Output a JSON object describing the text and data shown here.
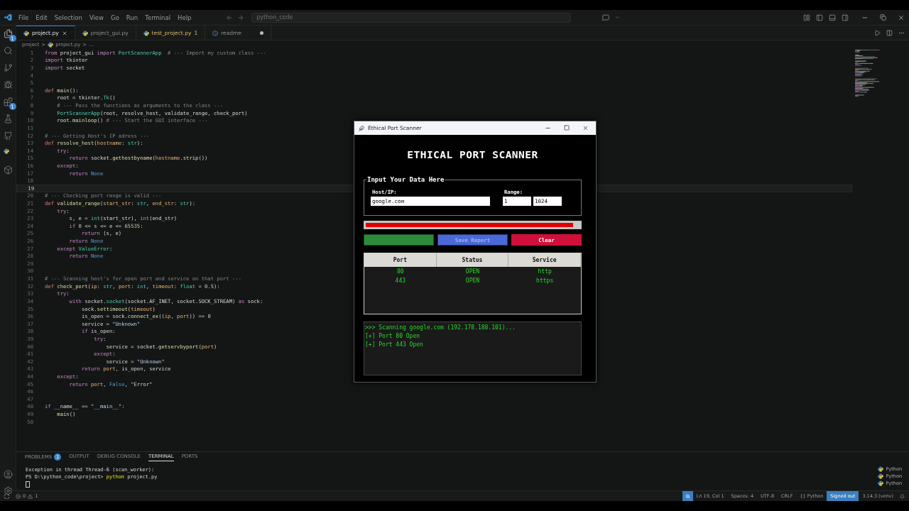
{
  "menu": [
    "File",
    "Edit",
    "Selection",
    "View",
    "Go",
    "Run",
    "Terminal",
    "Help"
  ],
  "search": {
    "value": "python_code"
  },
  "activity": [
    {
      "kind": "explorer",
      "badge": "1"
    },
    {
      "kind": "search"
    },
    {
      "kind": "git"
    },
    {
      "kind": "debug"
    },
    {
      "kind": "extensions",
      "badge": "1"
    },
    {
      "kind": "testing"
    },
    {
      "kind": "github"
    },
    {
      "kind": "python"
    },
    {
      "kind": "box"
    }
  ],
  "tabs": [
    {
      "label": "project.py",
      "selected": true,
      "kind": "python",
      "warning": false,
      "modified": false
    },
    {
      "label": "project_gui.py",
      "selected": false,
      "kind": "python",
      "warning": false,
      "modified": false
    },
    {
      "label": "test_project.py",
      "selected": false,
      "kind": "python",
      "warning": true,
      "badge": "1",
      "modified": false
    },
    {
      "label": "readme",
      "selected": false,
      "kind": "info",
      "warning": false,
      "modified": true
    }
  ],
  "breadcrumb": [
    {
      "label": "project",
      "separator": ">"
    },
    {
      "label": "project.py",
      "separator": ">"
    },
    {
      "label": "..."
    }
  ],
  "editor": {
    "lines": [
      {
        "num": "1",
        "current": false,
        "segments": [
          {
            "kind": "keyword",
            "text": "from"
          },
          {
            "kind": "plain",
            "text": " project_gui "
          },
          {
            "kind": "keyword",
            "text": "import"
          },
          {
            "kind": "type",
            "text": " PortScannerApp"
          },
          {
            "kind": "comment",
            "text": "  # --- Import my custom class ---"
          }
        ]
      },
      {
        "num": "2",
        "current": false,
        "segments": [
          {
            "kind": "keyword",
            "text": "import"
          },
          {
            "kind": "plain",
            "text": " tkinter"
          }
        ]
      },
      {
        "num": "3",
        "current": false,
        "segments": [
          {
            "kind": "keyword",
            "text": "import"
          },
          {
            "kind": "plain",
            "text": " socket"
          }
        ]
      },
      {
        "num": "4",
        "current": false
      },
      {
        "num": "5",
        "current": false
      },
      {
        "num": "6",
        "current": false,
        "segments": [
          {
            "kind": "def",
            "text": "def"
          },
          {
            "kind": "function",
            "text": " main"
          },
          {
            "kind": "plain",
            "text": "():"
          }
        ]
      },
      {
        "num": "7",
        "current": false,
        "segments": [
          {
            "kind": "plain",
            "text": "    root = tkinter."
          },
          {
            "kind": "type",
            "text": "Tk"
          },
          {
            "kind": "plain",
            "text": "()"
          }
        ]
      },
      {
        "num": "8",
        "current": false,
        "segments": [
          {
            "kind": "comment",
            "text": "    # --- Pass the functions as arguments to the class ---"
          }
        ]
      },
      {
        "num": "9",
        "current": false,
        "segments": [
          {
            "kind": "type",
            "text": "    PortScannerApp"
          },
          {
            "kind": "plain",
            "text": "(root, resolve_host, validate_range, check_port)"
          }
        ]
      },
      {
        "num": "10",
        "current": false,
        "segments": [
          {
            "kind": "plain",
            "text": "    root."
          },
          {
            "kind": "function",
            "text": "mainloop"
          },
          {
            "kind": "plain",
            "text": "() "
          },
          {
            "kind": "comment",
            "text": "# --- Start the GUI interface ---"
          }
        ]
      },
      {
        "num": "11",
        "current": false
      },
      {
        "num": "12",
        "current": false,
        "segments": [
          {
            "kind": "comment",
            "text": "# --- Getting Host's IP adress ---"
          }
        ]
      },
      {
        "num": "13",
        "current": false,
        "segments": [
          {
            "kind": "def",
            "text": "def"
          },
          {
            "kind": "function",
            "text": " resolve_host"
          },
          {
            "kind": "plain",
            "text": "("
          },
          {
            "kind": "param",
            "text": "hostname"
          },
          {
            "kind": "plain",
            "text": ": "
          },
          {
            "kind": "type",
            "text": "str"
          },
          {
            "kind": "plain",
            "text": "):"
          }
        ]
      },
      {
        "num": "14",
        "current": false,
        "segments": [
          {
            "kind": "keyword",
            "text": "    try"
          },
          {
            "kind": "plain",
            "text": ":"
          }
        ]
      },
      {
        "num": "15",
        "current": false,
        "segments": [
          {
            "kind": "keyword",
            "text": "        return"
          },
          {
            "kind": "plain",
            "text": " socket."
          },
          {
            "kind": "function",
            "text": "gethostbyname"
          },
          {
            "kind": "plain",
            "text": "("
          },
          {
            "kind": "param",
            "text": "hostname"
          },
          {
            "kind": "plain",
            "text": "."
          },
          {
            "kind": "function",
            "text": "strip"
          },
          {
            "kind": "plain",
            "text": "())"
          }
        ]
      },
      {
        "num": "16",
        "current": false,
        "segments": [
          {
            "kind": "keyword",
            "text": "    except"
          },
          {
            "kind": "plain",
            "text": ":"
          }
        ]
      },
      {
        "num": "17",
        "current": false,
        "segments": [
          {
            "kind": "keyword",
            "text": "        return"
          },
          {
            "kind": "constant",
            "text": " None"
          }
        ]
      },
      {
        "num": "18",
        "current": false
      },
      {
        "num": "19",
        "current": true
      },
      {
        "num": "20",
        "current": false,
        "segments": [
          {
            "kind": "comment",
            "text": "# --- Checking port range is valid ---"
          }
        ]
      },
      {
        "num": "21",
        "current": false,
        "segments": [
          {
            "kind": "def",
            "text": "def"
          },
          {
            "kind": "function",
            "text": " validate_range"
          },
          {
            "kind": "plain",
            "text": "("
          },
          {
            "kind": "param",
            "text": "start_str"
          },
          {
            "kind": "plain",
            "text": ": "
          },
          {
            "kind": "type",
            "text": "str"
          },
          {
            "kind": "plain",
            "text": ", "
          },
          {
            "kind": "param",
            "text": "end_str"
          },
          {
            "kind": "plain",
            "text": ": "
          },
          {
            "kind": "type",
            "text": "str"
          },
          {
            "kind": "plain",
            "text": "):"
          }
        ]
      },
      {
        "num": "22",
        "current": false,
        "segments": [
          {
            "kind": "keyword",
            "text": "    try"
          },
          {
            "kind": "plain",
            "text": ":"
          }
        ]
      },
      {
        "num": "23",
        "current": false,
        "segments": [
          {
            "kind": "plain",
            "text": "        s, e = "
          },
          {
            "kind": "type",
            "text": "int"
          },
          {
            "kind": "plain",
            "text": "(start_str), "
          },
          {
            "kind": "type",
            "text": "int"
          },
          {
            "kind": "plain",
            "text": "(end_str)"
          }
        ]
      },
      {
        "num": "24",
        "current": false,
        "segments": [
          {
            "kind": "keyword",
            "text": "        if"
          },
          {
            "kind": "number",
            "text": " 0"
          },
          {
            "kind": "plain",
            "text": " <= s <= e <= "
          },
          {
            "kind": "number",
            "text": "65535"
          },
          {
            "kind": "plain",
            "text": ":"
          }
        ]
      },
      {
        "num": "25",
        "current": false,
        "segments": [
          {
            "kind": "keyword",
            "text": "            return"
          },
          {
            "kind": "plain",
            "text": " (s, e)"
          }
        ]
      },
      {
        "num": "26",
        "current": false,
        "segments": [
          {
            "kind": "keyword",
            "text": "        return"
          },
          {
            "kind": "constant",
            "text": " None"
          }
        ]
      },
      {
        "num": "27",
        "current": false,
        "segments": [
          {
            "kind": "keyword",
            "text": "    except"
          },
          {
            "kind": "type",
            "text": " ValueError"
          },
          {
            "kind": "plain",
            "text": ":"
          }
        ]
      },
      {
        "num": "28",
        "current": false,
        "segments": [
          {
            "kind": "keyword",
            "text": "        return"
          },
          {
            "kind": "constant",
            "text": " None"
          }
        ]
      },
      {
        "num": "29",
        "current": false
      },
      {
        "num": "30",
        "current": false
      },
      {
        "num": "31",
        "current": false,
        "segments": [
          {
            "kind": "comment",
            "text": "# --- Scanning host's for open port and service on that port ---"
          }
        ]
      },
      {
        "num": "32",
        "current": false,
        "segments": [
          {
            "kind": "def",
            "text": "def"
          },
          {
            "kind": "function",
            "text": " check_port"
          },
          {
            "kind": "plain",
            "text": "("
          },
          {
            "kind": "param",
            "text": "ip"
          },
          {
            "kind": "plain",
            "text": ": "
          },
          {
            "kind": "type",
            "text": "str"
          },
          {
            "kind": "plain",
            "text": ", "
          },
          {
            "kind": "param",
            "text": "port"
          },
          {
            "kind": "plain",
            "text": ": "
          },
          {
            "kind": "type",
            "text": "int"
          },
          {
            "kind": "plain",
            "text": ", "
          },
          {
            "kind": "param",
            "text": "timeout"
          },
          {
            "kind": "plain",
            "text": ": "
          },
          {
            "kind": "type",
            "text": "float"
          },
          {
            "kind": "plain",
            "text": " = "
          },
          {
            "kind": "number",
            "text": "0.5"
          },
          {
            "kind": "plain",
            "text": "):"
          }
        ]
      },
      {
        "num": "33",
        "current": false,
        "segments": [
          {
            "kind": "keyword",
            "text": "    try"
          },
          {
            "kind": "plain",
            "text": ":"
          }
        ]
      },
      {
        "num": "34",
        "current": false,
        "segments": [
          {
            "kind": "keyword",
            "text": "        with"
          },
          {
            "kind": "plain",
            "text": " socket."
          },
          {
            "kind": "type",
            "text": "socket"
          },
          {
            "kind": "plain",
            "text": "(socket.AF_INET, socket.SOCK_STREAM) "
          },
          {
            "kind": "keyword",
            "text": "as"
          },
          {
            "kind": "plain",
            "text": " sock:"
          }
        ]
      },
      {
        "num": "35",
        "current": false,
        "segments": [
          {
            "kind": "plain",
            "text": "            sock."
          },
          {
            "kind": "function",
            "text": "settimeout"
          },
          {
            "kind": "plain",
            "text": "("
          },
          {
            "kind": "param",
            "text": "timeout"
          },
          {
            "kind": "plain",
            "text": ")"
          }
        ]
      },
      {
        "num": "36",
        "current": false,
        "segments": [
          {
            "kind": "plain",
            "text": "            is_open = sock."
          },
          {
            "kind": "function",
            "text": "connect_ex"
          },
          {
            "kind": "plain",
            "text": "(("
          },
          {
            "kind": "param",
            "text": "ip"
          },
          {
            "kind": "plain",
            "text": ", "
          },
          {
            "kind": "param",
            "text": "port"
          },
          {
            "kind": "plain",
            "text": ")) == "
          },
          {
            "kind": "number",
            "text": "0"
          }
        ]
      },
      {
        "num": "37",
        "current": false,
        "segments": [
          {
            "kind": "plain",
            "text": "            service = "
          },
          {
            "kind": "string",
            "text": "\"Unknown\""
          }
        ]
      },
      {
        "num": "38",
        "current": false,
        "segments": [
          {
            "kind": "keyword",
            "text": "            if"
          },
          {
            "kind": "plain",
            "text": " is_open:"
          }
        ]
      },
      {
        "num": "39",
        "current": false,
        "segments": [
          {
            "kind": "keyword",
            "text": "                try"
          },
          {
            "kind": "plain",
            "text": ":"
          }
        ]
      },
      {
        "num": "40",
        "current": false,
        "segments": [
          {
            "kind": "plain",
            "text": "                    service = socket."
          },
          {
            "kind": "function",
            "text": "getservbyport"
          },
          {
            "kind": "plain",
            "text": "("
          },
          {
            "kind": "param",
            "text": "port"
          },
          {
            "kind": "plain",
            "text": ")"
          }
        ]
      },
      {
        "num": "41",
        "current": false,
        "segments": [
          {
            "kind": "keyword",
            "text": "                except"
          },
          {
            "kind": "plain",
            "text": ":"
          }
        ]
      },
      {
        "num": "42",
        "current": false,
        "segments": [
          {
            "kind": "plain",
            "text": "                    service = "
          },
          {
            "kind": "string",
            "text": "\"Unknown\""
          }
        ]
      },
      {
        "num": "43",
        "current": false,
        "segments": [
          {
            "kind": "keyword",
            "text": "            return"
          },
          {
            "kind": "param",
            "text": " port"
          },
          {
            "kind": "plain",
            "text": ", is_open, service"
          }
        ]
      },
      {
        "num": "44",
        "current": false,
        "segments": [
          {
            "kind": "keyword",
            "text": "    except"
          },
          {
            "kind": "plain",
            "text": ":"
          }
        ]
      },
      {
        "num": "45",
        "current": false,
        "segments": [
          {
            "kind": "keyword",
            "text": "        return"
          },
          {
            "kind": "param",
            "text": " port"
          },
          {
            "kind": "plain",
            "text": ", "
          },
          {
            "kind": "constant",
            "text": "False"
          },
          {
            "kind": "plain",
            "text": ", "
          },
          {
            "kind": "string",
            "text": "\"Error\""
          }
        ]
      },
      {
        "num": "46",
        "current": false
      },
      {
        "num": "47",
        "current": false
      },
      {
        "num": "48",
        "current": false,
        "segments": [
          {
            "kind": "keyword",
            "text": "if"
          },
          {
            "kind": "plain",
            "text": " __name__ == "
          },
          {
            "kind": "string",
            "text": "\"__main__\""
          },
          {
            "kind": "plain",
            "text": ":"
          }
        ]
      },
      {
        "num": "49",
        "current": false,
        "segments": [
          {
            "kind": "function",
            "text": "    main"
          },
          {
            "kind": "plain",
            "text": "()"
          }
        ]
      },
      {
        "num": "50",
        "current": false
      }
    ]
  },
  "panel": {
    "tabs": [
      {
        "label": "PROBLEMS",
        "selected": false,
        "badge": "1"
      },
      {
        "label": "OUTPUT",
        "selected": false
      },
      {
        "label": "DEBUG CONSOLE",
        "selected": false
      },
      {
        "label": "TERMINAL",
        "selected": true
      },
      {
        "label": "PORTS",
        "selected": false
      }
    ],
    "terminal": [
      {
        "segments": [
          {
            "kind": "plain",
            "text": "Exception in thread Thread-6 (scan_worker):"
          }
        ]
      },
      {
        "segments": [
          {
            "kind": "plain",
            "text": "PS D:\\python_code\\project> "
          },
          {
            "kind": "command",
            "text": "python"
          },
          {
            "kind": "plain",
            "text": " project.py"
          }
        ]
      }
    ],
    "shells": [
      "Python",
      "Python",
      "Python"
    ]
  },
  "status_bar": {
    "errors": "0",
    "warnings": "1",
    "items": [
      {
        "label": "Ln 19, Col 1",
        "highlight": false
      },
      {
        "label": "Spaces: 4",
        "highlight": false
      },
      {
        "label": "UTF-8",
        "highlight": false
      },
      {
        "label": "CRLF",
        "highlight": false
      },
      {
        "label": "{} Python",
        "highlight": false
      },
      {
        "label": "Signed out",
        "highlight": true
      },
      {
        "label": "3.14.3 (venv)",
        "highlight": false
      }
    ]
  },
  "scanner": {
    "title": "Ethical Port Scanner",
    "heading": "ETHICAL PORT SCANNER",
    "group": "Input Your Data Here",
    "host_label": "Host/IP:",
    "host": "google.com",
    "range_label": "Range:",
    "range_start": "1",
    "range_end": "1024",
    "progress": {
      "level": 0.97
    },
    "buttons": [
      {
        "color": "#2e8b3a",
        "disabled": true
      },
      {
        "label": "Save Report",
        "color": "#4a68d6",
        "disabled": true
      },
      {
        "label": "Clear",
        "color": "#d0103a",
        "disabled": false
      }
    ],
    "columns": [
      "Port",
      "Status",
      "Service"
    ],
    "rows": [
      [
        "80",
        "OPEN",
        "http"
      ],
      [
        "443",
        "OPEN",
        "https"
      ]
    ],
    "log": [
      ">>> Scanning google.com (192.178.188.101)...",
      "[+] Port 80 Open",
      "[+] Port 443 Open"
    ]
  }
}
